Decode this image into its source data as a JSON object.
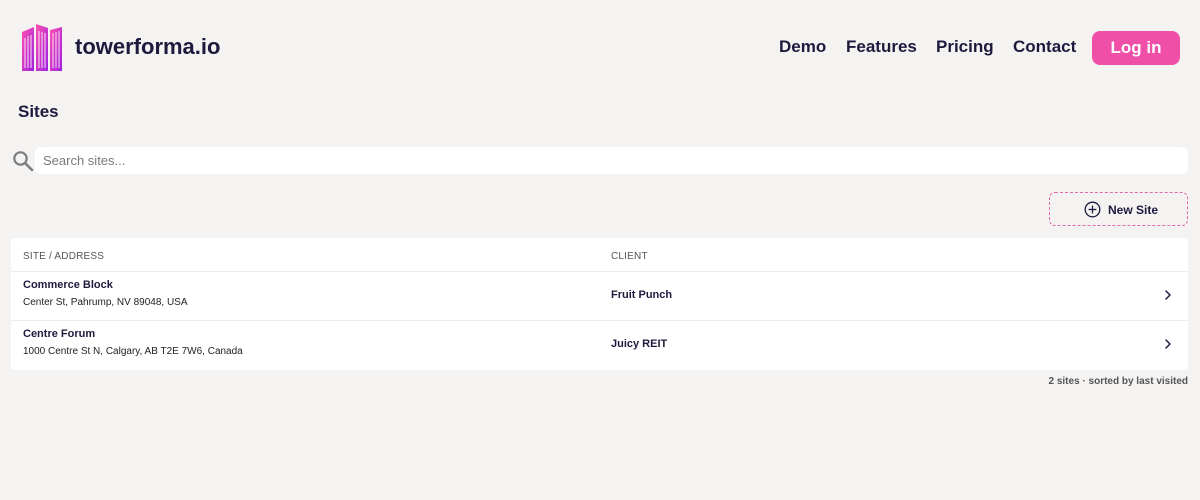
{
  "header": {
    "brand": "towerforma.io",
    "nav": [
      "Demo",
      "Features",
      "Pricing",
      "Contact"
    ],
    "login_label": "Log in"
  },
  "page": {
    "title": "Sites"
  },
  "search": {
    "placeholder": "Search sites..."
  },
  "actions": {
    "new_site_label": "New Site"
  },
  "table": {
    "columns": [
      "SITE / ADDRESS",
      "CLIENT"
    ],
    "rows": [
      {
        "name": "Commerce Block",
        "address": "Center St, Pahrump, NV 89048, USA",
        "client": "Fruit Punch"
      },
      {
        "name": "Centre Forum",
        "address": "1000 Centre St N, Calgary, AB T2E 7W6, Canada",
        "client": "Juicy REIT"
      }
    ]
  },
  "footer": {
    "summary": "2 sites · sorted by last visited"
  },
  "colors": {
    "accent": "#ef4fa6",
    "text": "#1d1a3d",
    "background": "#f5f3f2"
  },
  "icons": {
    "logo": "building-logo-icon",
    "search": "search-icon",
    "new": "plus-circle-icon",
    "row": "chevron-right-icon"
  }
}
